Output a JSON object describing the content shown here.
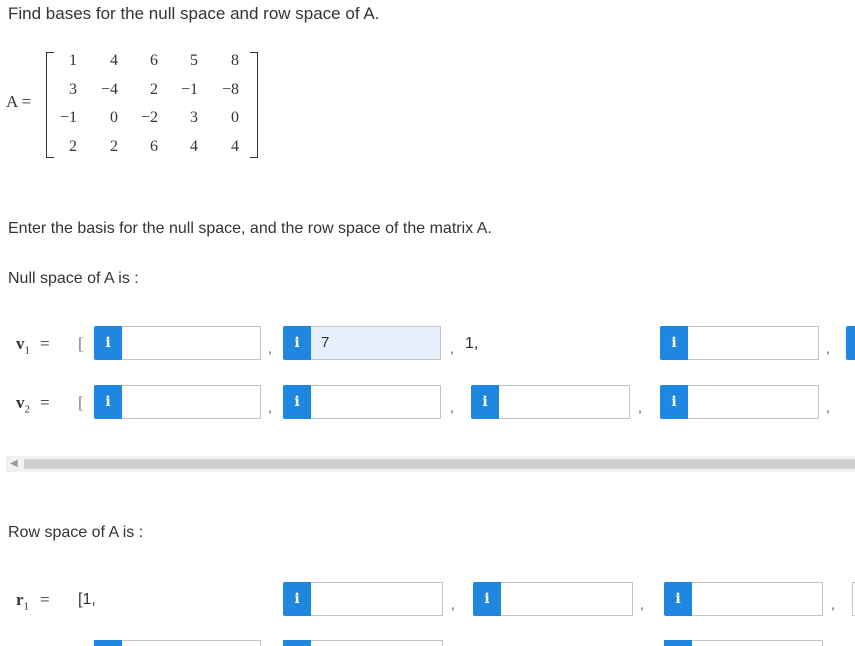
{
  "question": "Find bases for the null space and row space of A.",
  "matrix": {
    "label": "A =",
    "rows": [
      [
        "1",
        "4",
        "6",
        "5",
        "8"
      ],
      [
        "3",
        "−4",
        "2",
        "−1",
        "−8"
      ],
      [
        "−1",
        "0",
        "−2",
        "3",
        "0"
      ],
      [
        "2",
        "2",
        "6",
        "4",
        "4"
      ]
    ]
  },
  "instruction": "Enter the basis for the null space, and the row space of the matrix A.",
  "null_space_label": "Null space of A is :",
  "v1": {
    "label_bold": "v",
    "subscript": "1",
    "equals": "=",
    "open_bracket": "[",
    "field2_value": "7",
    "text_after_field2": "1,"
  },
  "v2": {
    "label_bold": "v",
    "subscript": "2",
    "equals": "=",
    "open_bracket": "["
  },
  "row_space_label": "Row space of A is :",
  "r1": {
    "label_bold": "r",
    "subscript": "1",
    "equals": "=",
    "prefix": "[1,"
  },
  "info_glyph": "i",
  "comma": ",",
  "icons": {
    "info": "info-icon",
    "scroll_left": "scroll-left-arrow-icon"
  },
  "colors": {
    "info_button": "#1f87e0",
    "filled_input": "#e6eefc",
    "input_border": "#c4c4c4"
  }
}
